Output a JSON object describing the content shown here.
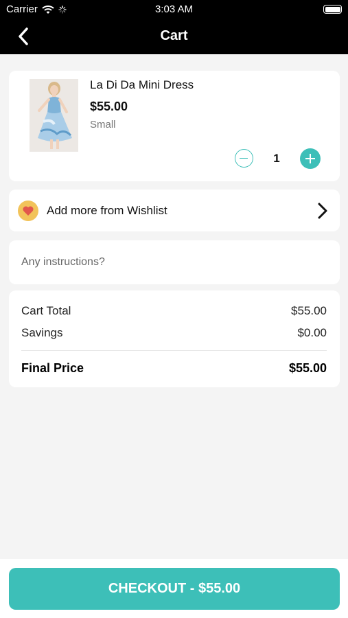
{
  "status_bar": {
    "carrier": "Carrier",
    "time": "3:03 AM"
  },
  "nav": {
    "title": "Cart"
  },
  "cart_item": {
    "name": "La Di Da Mini Dress",
    "price": "$55.00",
    "size": "Small",
    "quantity": "1"
  },
  "wishlist": {
    "label": "Add more from Wishlist"
  },
  "instructions": {
    "placeholder": "Any instructions?"
  },
  "summary": {
    "cart_total_label": "Cart Total",
    "cart_total_value": "$55.00",
    "savings_label": "Savings",
    "savings_value": "$0.00",
    "final_label": "Final Price",
    "final_value": "$55.00"
  },
  "checkout": {
    "label": "CHECKOUT - $55.00"
  },
  "colors": {
    "accent": "#3dbfb8",
    "nav_background": "#000000",
    "heart_badge": "#f2c35a",
    "heart": "#e2574c"
  },
  "icons": [
    "wifi-icon",
    "activity-spinner-icon",
    "battery-icon",
    "back-chevron-icon",
    "minus-icon",
    "plus-icon",
    "heart-icon",
    "chevron-right-icon"
  ]
}
